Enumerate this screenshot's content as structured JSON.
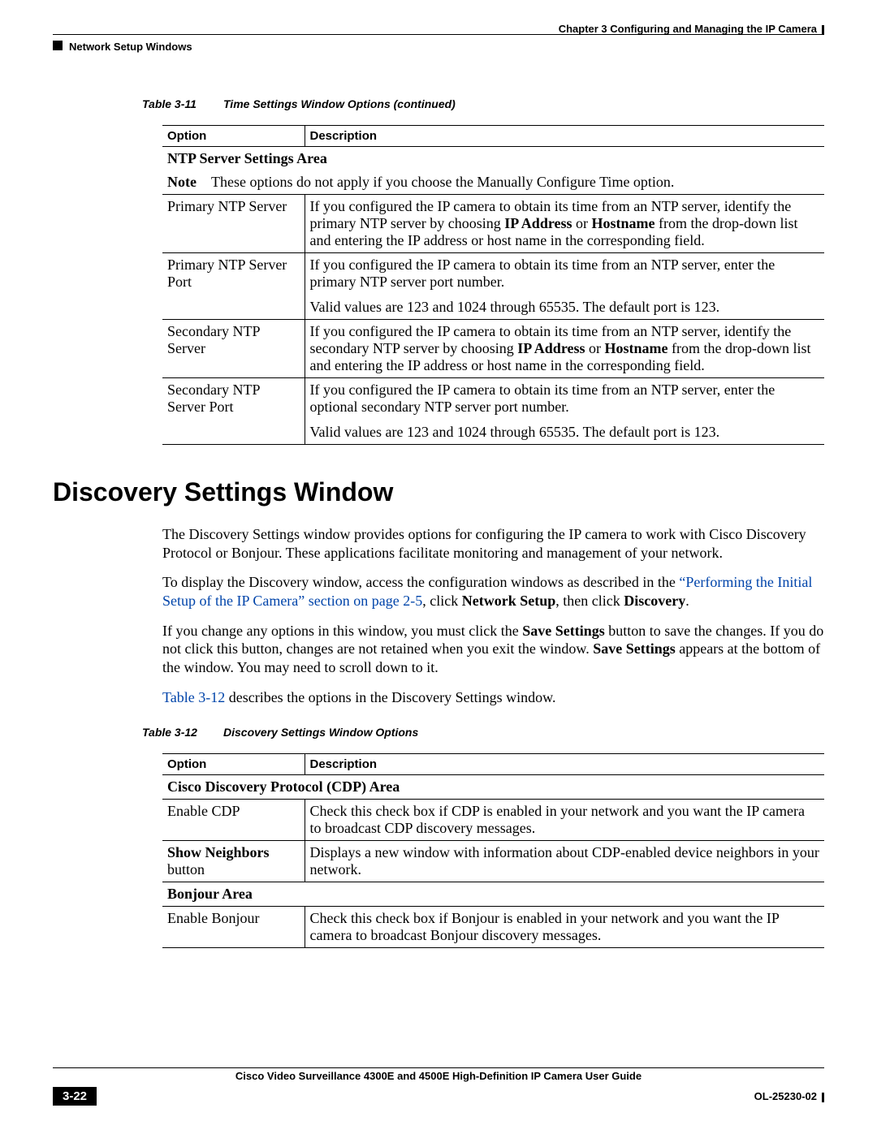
{
  "header": {
    "chapter": "Chapter 3      Configuring and Managing the IP Camera",
    "section": "Network Setup Windows"
  },
  "table311": {
    "caption_num": "Table 3-11",
    "caption_text": "Time Settings Window Options (continued)",
    "h_option": "Option",
    "h_desc": "Description",
    "area": "NTP Server Settings Area",
    "note_label": "Note",
    "note_text": "These options do not apply if you choose the Manually Configure Time option.",
    "r1o": "Primary NTP Server",
    "r1d_a": "If you configured the IP camera to obtain its time from an NTP server, identify the primary NTP server by choosing ",
    "r1d_b": "IP Address",
    "r1d_c": " or ",
    "r1d_d": "Hostname",
    "r1d_e": " from the drop-down list and entering the IP address or host name in the corresponding field.",
    "r2o": "Primary NTP Server Port",
    "r2d_p1": "If you configured the IP camera to obtain its time from an NTP server, enter the primary NTP server port number.",
    "r2d_p2": "Valid values are 123 and 1024 through 65535. The default port is 123.",
    "r3o": "Secondary NTP Server",
    "r3d_a": "If you configured the IP camera to obtain its time from an NTP server, identify the secondary NTP server by choosing ",
    "r3d_b": "IP Address",
    "r3d_c": " or ",
    "r3d_d": "Hostname",
    "r3d_e": " from the drop-down list and entering the IP address or host name in the corresponding field.",
    "r4o": "Secondary NTP Server Port",
    "r4d_p1": "If you configured the IP camera to obtain its time from an NTP server, enter the optional secondary NTP server port number.",
    "r4d_p2": "Valid values are 123 and 1024 through 65535. The default port is 123."
  },
  "section_heading": "Discovery Settings Window",
  "para1": "The Discovery Settings window provides options for configuring the IP camera to work with Cisco Discovery Protocol or Bonjour. These applications facilitate monitoring and management of your network.",
  "para2_a": "To display the Discovery window, access the configuration windows as described in the ",
  "para2_link": "“Performing the Initial Setup of the IP Camera” section on page 2-5",
  "para2_b": ", click ",
  "para2_bold1": "Network Setup",
  "para2_c": ", then click ",
  "para2_bold2": "Discovery",
  "para2_d": ".",
  "para3_a": "If you change any options in this window, you must click the ",
  "para3_bold1": "Save Settings",
  "para3_b": " button to save the changes. If you do not click this button, changes are not retained when you exit the window. ",
  "para3_bold2": "Save Settings",
  "para3_c": " appears at the bottom of the window. You may need to scroll down to it.",
  "para4_link": "Table 3-12",
  "para4_b": " describes the options in the Discovery Settings window.",
  "table312": {
    "caption_num": "Table 3-12",
    "caption_text": "Discovery Settings Window Options",
    "h_option": "Option",
    "h_desc": "Description",
    "area1": "Cisco Discovery Protocol (CDP) Area",
    "r1o": "Enable CDP",
    "r1d": "Check this check box if CDP is enabled in your network and you want the IP camera to broadcast CDP discovery messages.",
    "r2o_bold": "Show Neighbors",
    "r2o_rest": " button",
    "r2d": "Displays a new window with information about CDP-enabled device neighbors in your network.",
    "area2": "Bonjour Area",
    "r3o": "Enable Bonjour",
    "r3d": "Check this check box if Bonjour is enabled in your network and you want the IP camera to broadcast Bonjour discovery messages."
  },
  "footer": {
    "title": "Cisco Video Surveillance 4300E and 4500E High-Definition IP Camera User Guide",
    "page": "3-22",
    "docnum": "OL-25230-02"
  }
}
